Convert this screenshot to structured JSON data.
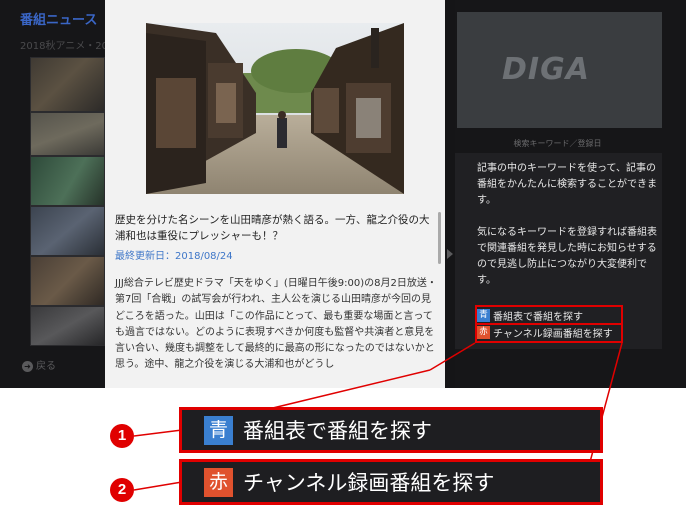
{
  "left_panel": {
    "title": "番組ニュース",
    "subtitle": "2018秋アニメ・20",
    "back_label": "戻る"
  },
  "article": {
    "headline": "歴史を分けた名シーンを山田晴彦が熱く語る。一方、龍之介役の大浦和也は重役にプレッシャーも！？",
    "date": "最終更新日：2018/08/24",
    "body": "JJJ総合テレビ歴史ドラマ「天をゆく」(日曜日午後9:00)の8月2日放送・第7回「合戦」の試写会が行われ、主人公を演じる山田晴彦が今回の見どころを語った。山田は「この作品にとって、最も重要な場面と言っても過言ではない。どのように表現すべきか何度も監督や共演者と意見を言い合い、幾度も調整をして最終的に最高の形になったのではないかと思う。途中、龍之介役を演じる大浦和也がどうし"
  },
  "right_panel": {
    "logo": "DIGA",
    "keyword_label": "検索キーワード／登録日",
    "desc_1": "記事の中のキーワードを使って、記事の番組をかんたんに検索することができます。",
    "desc_2": "気になるキーワードを登録すれば番組表で関連番組を発見した時にお知らせするので見逃し防止につながり大変便利です。",
    "buttons": [
      {
        "key": "青",
        "label": "番組表で番組を探す",
        "color": "#3a7fd0"
      },
      {
        "key": "赤",
        "label": "チャンネル録画番組を探す",
        "color": "#e0522e"
      }
    ]
  },
  "callouts": [
    {
      "number": "1",
      "key": "青",
      "label": "番組表で番組を探す"
    },
    {
      "number": "2",
      "key": "赤",
      "label": "チャンネル録画番組を探す"
    }
  ],
  "colors": {
    "highlight": "#e00000",
    "blue_key": "#3a7fd0",
    "red_key": "#e0522e",
    "link": "#3f77c8"
  }
}
